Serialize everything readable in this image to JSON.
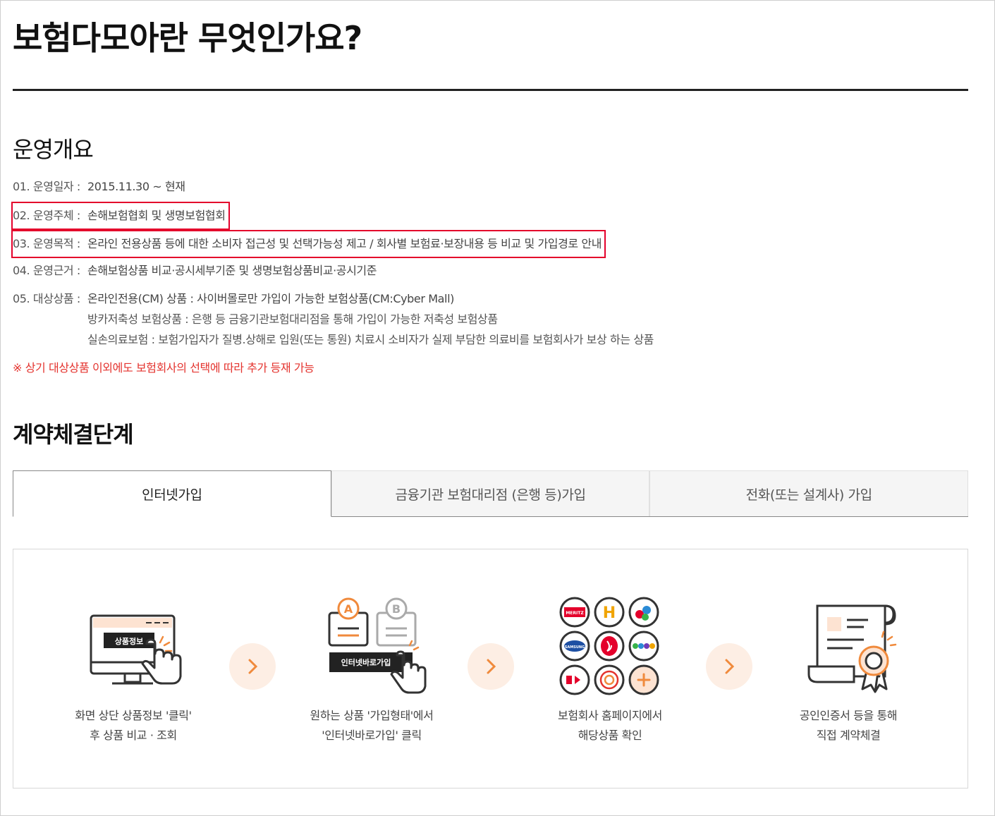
{
  "page": {
    "title": "보험다모아란 무엇인가요?"
  },
  "overview": {
    "heading": "운영개요",
    "rows": [
      {
        "label": "01. 운영일자 :",
        "value": "2015.11.30 ~ 현재"
      },
      {
        "label": "02. 운영주체 :",
        "value": "손해보험협회 및 생명보험협회"
      },
      {
        "label": "03. 운영목적 :",
        "value": "온라인 전용상품 등에 대한 소비자 접근성 및 선택가능성 제고 / 회사별 보험료·보장내용 등 비교 및 가입경로 안내"
      },
      {
        "label": "04. 운영근거 :",
        "value": "손해보험상품 비교·공시세부기준 및 생명보험상품비교·공시기준"
      },
      {
        "label": "05. 대상상품 :",
        "value": "온라인전용(CM) 상품 : 사이버몰로만 가입이 가능한 보험상품(CM:Cyber Mall)"
      }
    ],
    "products_extra": [
      "방카저축성 보험상품 : 은행 등 금융기관보험대리점을 통해 가입이 가능한 저축성 보험상품",
      "실손의료보험 : 보험가입자가 질병.상해로 입원(또는 통원) 치료시 소비자가 실제 부담한 의료비를 보험회사가 보상 하는 상품"
    ],
    "note": "※ 상기 대상상품 이외에도 보험회사의 선택에 따라 추가 등재 가능"
  },
  "steps_section": {
    "heading": "계약체결단계",
    "tabs": [
      {
        "label": "인터넷가입",
        "active": true
      },
      {
        "label": "금융기관 보험대리점 (은행 등)가입",
        "active": false
      },
      {
        "label": "전화(또는 설계사) 가입",
        "active": false
      }
    ],
    "steps": [
      {
        "icon": "monitor-click-icon",
        "badge": "상품정보",
        "caption_line1": "화면 상단 상품정보 '클릭'",
        "caption_line2": "후 상품 비교 · 조회"
      },
      {
        "icon": "plan-select-icon",
        "badge": "인터넷바로가입",
        "caption_line1": "원하는 상품 '가입형태'에서",
        "caption_line2": "'인터넷바로가입' 클릭"
      },
      {
        "icon": "insurer-logos-icon",
        "badge": "MERITZ",
        "caption_line1": "보험회사 홈페이지에서",
        "caption_line2": "해당상품 확인"
      },
      {
        "icon": "certificate-icon",
        "caption_line1": "공인인증서 등을 통해",
        "caption_line2": "직접 계약체결"
      }
    ],
    "logo_texts": [
      "SAMSUNG"
    ],
    "accent_color": "#f08a3c",
    "highlight_color": "#e4002b"
  }
}
